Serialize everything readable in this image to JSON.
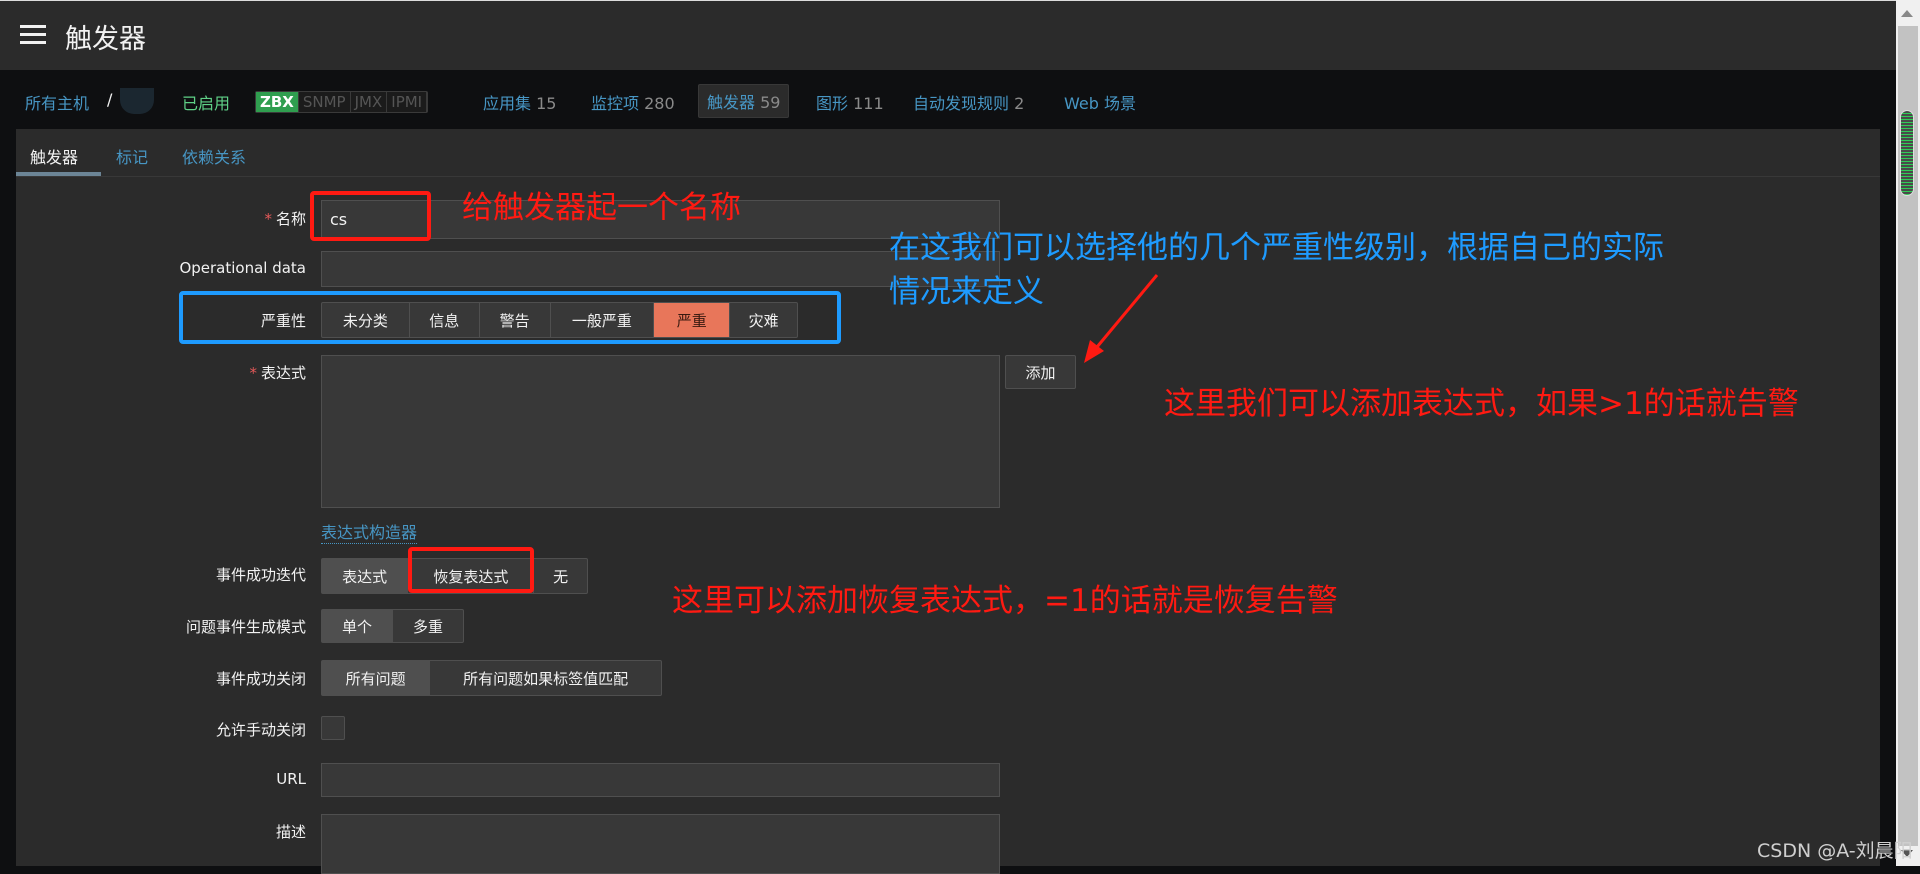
{
  "header": {
    "title": "触发器"
  },
  "nav": {
    "all_hosts": "所有主机",
    "separator": "/",
    "enabled": "已启用",
    "tags": [
      "ZBX",
      "SNMP",
      "JMX",
      "IPMI"
    ],
    "items": [
      {
        "label": "应用集",
        "count": "15"
      },
      {
        "label": "监控项",
        "count": "280"
      },
      {
        "label": "触发器",
        "count": "59"
      },
      {
        "label": "图形",
        "count": "111"
      },
      {
        "label": "自动发现规则",
        "count": "2"
      },
      {
        "label": "Web 场景",
        "count": ""
      }
    ]
  },
  "tabs": [
    "触发器",
    "标记",
    "依赖关系"
  ],
  "form": {
    "required_mark": "*",
    "name_label": "名称",
    "name_value": "cs",
    "opdata_label": "Operational data",
    "severity_label": "严重性",
    "severities": [
      "未分类",
      "信息",
      "警告",
      "一般严重",
      "严重",
      "灾难"
    ],
    "severity_selected": "严重",
    "expression_label": "表达式",
    "add_button": "添加",
    "expression_builder_link": "表达式构造器",
    "ok_event_gen_label": "事件成功迭代",
    "ok_event_gen_options": [
      "表达式",
      "恢复表达式",
      "无"
    ],
    "problem_mode_label": "问题事件生成模式",
    "problem_mode_options": [
      "单个",
      "多重"
    ],
    "ok_close_label": "事件成功关闭",
    "ok_close_options": [
      "所有问题",
      "所有问题如果标签值匹配"
    ],
    "manual_close_label": "允许手动关闭",
    "url_label": "URL",
    "description_label": "描述"
  },
  "annotations": {
    "name_note": "给触发器起一个名称",
    "severity_note_line1": "在这我们可以选择他的几个严重性级别，根据自己的实际",
    "severity_note_line2": "情况来定义",
    "expression_note": "这里我们可以添加表达式，如果>1的话就告警",
    "recovery_note": "这里可以添加恢复表达式，=1的话就是恢复告警",
    "red": "#ff1a12",
    "blue": "#1e9bff"
  },
  "watermark": "CSDN @A-刘晨阳"
}
